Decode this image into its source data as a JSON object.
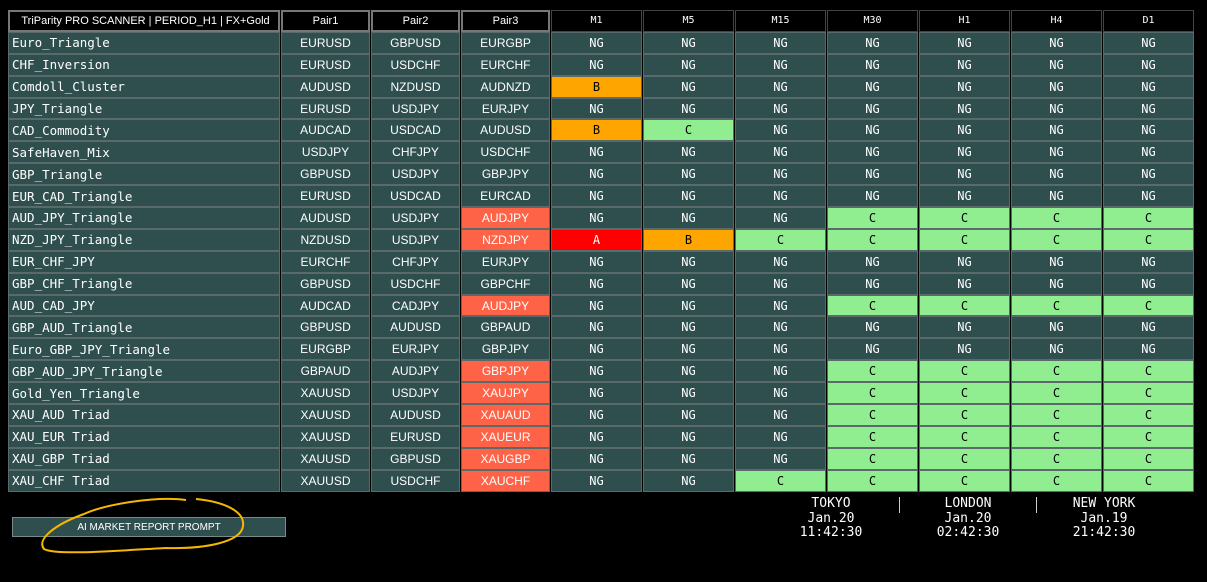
{
  "header": {
    "title": "TriParity PRO SCANNER | PERIOD_H1 | FX+Gold",
    "pair1": "Pair1",
    "pair2": "Pair2",
    "pair3": "Pair3",
    "timeframes": [
      "M1",
      "M5",
      "M15",
      "M30",
      "H1",
      "H4",
      "D1"
    ]
  },
  "colors": {
    "row_bg": "#2f4f4f",
    "NG": "#2f4f4f",
    "A": "#ff0000",
    "B": "#ffa500",
    "C": "#90ee90",
    "pair3_highlight": "#ff6347"
  },
  "rows": [
    {
      "name": "Euro_Triangle",
      "p1": "EURUSD",
      "p2": "GBPUSD",
      "p3": "EURGBP",
      "hl": false,
      "s": [
        "NG",
        "NG",
        "NG",
        "NG",
        "NG",
        "NG",
        "NG"
      ]
    },
    {
      "name": "CHF_Inversion",
      "p1": "EURUSD",
      "p2": "USDCHF",
      "p3": "EURCHF",
      "hl": false,
      "s": [
        "NG",
        "NG",
        "NG",
        "NG",
        "NG",
        "NG",
        "NG"
      ]
    },
    {
      "name": "Comdoll_Cluster",
      "p1": "AUDUSD",
      "p2": "NZDUSD",
      "p3": "AUDNZD",
      "hl": false,
      "s": [
        "B",
        "NG",
        "NG",
        "NG",
        "NG",
        "NG",
        "NG"
      ]
    },
    {
      "name": "JPY_Triangle",
      "p1": "EURUSD",
      "p2": "USDJPY",
      "p3": "EURJPY",
      "hl": false,
      "s": [
        "NG",
        "NG",
        "NG",
        "NG",
        "NG",
        "NG",
        "NG"
      ]
    },
    {
      "name": "CAD_Commodity",
      "p1": "AUDCAD",
      "p2": "USDCAD",
      "p3": "AUDUSD",
      "hl": false,
      "s": [
        "B",
        "C",
        "NG",
        "NG",
        "NG",
        "NG",
        "NG"
      ]
    },
    {
      "name": "SafeHaven_Mix",
      "p1": "USDJPY",
      "p2": "CHFJPY",
      "p3": "USDCHF",
      "hl": false,
      "s": [
        "NG",
        "NG",
        "NG",
        "NG",
        "NG",
        "NG",
        "NG"
      ]
    },
    {
      "name": "GBP_Triangle",
      "p1": "GBPUSD",
      "p2": "USDJPY",
      "p3": "GBPJPY",
      "hl": false,
      "s": [
        "NG",
        "NG",
        "NG",
        "NG",
        "NG",
        "NG",
        "NG"
      ]
    },
    {
      "name": "EUR_CAD_Triangle",
      "p1": "EURUSD",
      "p2": "USDCAD",
      "p3": "EURCAD",
      "hl": false,
      "s": [
        "NG",
        "NG",
        "NG",
        "NG",
        "NG",
        "NG",
        "NG"
      ]
    },
    {
      "name": "AUD_JPY_Triangle",
      "p1": "AUDUSD",
      "p2": "USDJPY",
      "p3": "AUDJPY",
      "hl": true,
      "s": [
        "NG",
        "NG",
        "NG",
        "C",
        "C",
        "C",
        "C"
      ]
    },
    {
      "name": "NZD_JPY_Triangle",
      "p1": "NZDUSD",
      "p2": "USDJPY",
      "p3": "NZDJPY",
      "hl": true,
      "s": [
        "A",
        "B",
        "C",
        "C",
        "C",
        "C",
        "C"
      ]
    },
    {
      "name": "EUR_CHF_JPY",
      "p1": "EURCHF",
      "p2": "CHFJPY",
      "p3": "EURJPY",
      "hl": false,
      "s": [
        "NG",
        "NG",
        "NG",
        "NG",
        "NG",
        "NG",
        "NG"
      ]
    },
    {
      "name": "GBP_CHF_Triangle",
      "p1": "GBPUSD",
      "p2": "USDCHF",
      "p3": "GBPCHF",
      "hl": false,
      "s": [
        "NG",
        "NG",
        "NG",
        "NG",
        "NG",
        "NG",
        "NG"
      ]
    },
    {
      "name": "AUD_CAD_JPY",
      "p1": "AUDCAD",
      "p2": "CADJPY",
      "p3": "AUDJPY",
      "hl": true,
      "s": [
        "NG",
        "NG",
        "NG",
        "C",
        "C",
        "C",
        "C"
      ]
    },
    {
      "name": "GBP_AUD_Triangle",
      "p1": "GBPUSD",
      "p2": "AUDUSD",
      "p3": "GBPAUD",
      "hl": false,
      "s": [
        "NG",
        "NG",
        "NG",
        "NG",
        "NG",
        "NG",
        "NG"
      ]
    },
    {
      "name": "Euro_GBP_JPY_Triangle",
      "p1": "EURGBP",
      "p2": "EURJPY",
      "p3": "GBPJPY",
      "hl": false,
      "s": [
        "NG",
        "NG",
        "NG",
        "NG",
        "NG",
        "NG",
        "NG"
      ]
    },
    {
      "name": "GBP_AUD_JPY_Triangle",
      "p1": "GBPAUD",
      "p2": "AUDJPY",
      "p3": "GBPJPY",
      "hl": true,
      "s": [
        "NG",
        "NG",
        "NG",
        "C",
        "C",
        "C",
        "C"
      ]
    },
    {
      "name": "Gold_Yen_Triangle",
      "p1": "XAUUSD",
      "p2": "USDJPY",
      "p3": "XAUJPY",
      "hl": true,
      "s": [
        "NG",
        "NG",
        "NG",
        "C",
        "C",
        "C",
        "C"
      ]
    },
    {
      "name": "XAU_AUD Triad",
      "p1": "XAUUSD",
      "p2": "AUDUSD",
      "p3": "XAUAUD",
      "hl": true,
      "s": [
        "NG",
        "NG",
        "NG",
        "C",
        "C",
        "C",
        "C"
      ]
    },
    {
      "name": "XAU_EUR Triad",
      "p1": "XAUUSD",
      "p2": "EURUSD",
      "p3": "XAUEUR",
      "hl": true,
      "s": [
        "NG",
        "NG",
        "NG",
        "C",
        "C",
        "C",
        "C"
      ]
    },
    {
      "name": "XAU_GBP Triad",
      "p1": "XAUUSD",
      "p2": "GBPUSD",
      "p3": "XAUGBP",
      "hl": true,
      "s": [
        "NG",
        "NG",
        "NG",
        "C",
        "C",
        "C",
        "C"
      ]
    },
    {
      "name": "XAU_CHF Triad",
      "p1": "XAUUSD",
      "p2": "USDCHF",
      "p3": "XAUCHF",
      "hl": true,
      "s": [
        "NG",
        "NG",
        "C",
        "C",
        "C",
        "C",
        "C"
      ]
    }
  ],
  "report_button": "AI MARKET REPORT PROMPT",
  "clocks": [
    {
      "city": "TOKYO",
      "date": "Jan.20",
      "time": "11:42:30"
    },
    {
      "city": "LONDON",
      "date": "Jan.20",
      "time": "02:42:30"
    },
    {
      "city": "NEW YORK",
      "date": "Jan.19",
      "time": "21:42:30"
    }
  ]
}
